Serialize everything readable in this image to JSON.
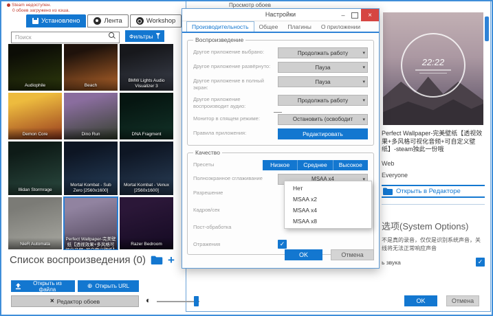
{
  "colors": {
    "accent": "#1377d0",
    "close_red": "#d64541",
    "status_red": "#c0392b"
  },
  "status": {
    "line1": "Steam недоступен.",
    "line2": "0 обоев загружено из кэша."
  },
  "browser": {
    "tabs": [
      {
        "label": "Установлено"
      },
      {
        "label": "Лента"
      },
      {
        "label": "Workshop"
      }
    ],
    "search_placeholder": "Поиск",
    "filters_label": "Фильтры",
    "tiles": [
      {
        "name": "Audiophile",
        "c1": "#0c0d06",
        "c2": "#2e3a0c"
      },
      {
        "name": "Beach",
        "c1": "#1f120b",
        "c2": "#b5652a"
      },
      {
        "name": "BMW Lights Audio Visualizer 3",
        "c1": "#17181c",
        "c2": "#3c414d"
      },
      {
        "name": "Demon Core",
        "c1": "#edbb3e",
        "c2": "#973a1e"
      },
      {
        "name": "Dino Run",
        "c1": "#8a6d9e",
        "c2": "#35402e"
      },
      {
        "name": "DNA Fragment",
        "c1": "#061611",
        "c2": "#123228"
      },
      {
        "name": "Illidan Stormrage",
        "c1": "#0e1b17",
        "c2": "#2b4a40"
      },
      {
        "name": "Mortal Kombat - Sub Zero [2560x1600]",
        "c1": "#0d1523",
        "c2": "#27405c"
      },
      {
        "name": "Mortal Kombat - Venux [2560x1600]",
        "c1": "#0e1624",
        "c2": "#2a3f58"
      },
      {
        "name": "NieR Automata",
        "c1": "#7b7b76",
        "c2": "#a8a8a1"
      },
      {
        "name": "Perfect Wallpaper-完美壁纸【透视效果+多风格可视化音频+可自定义壁纸】",
        "c1": "#9183a0",
        "c2": "#4e4458"
      },
      {
        "name": "Razer Bedroom",
        "c1": "#2b1738",
        "c2": "#140a22"
      }
    ],
    "playlist_heading": "Список воспроизведения (0)",
    "open_from_file_label": "Открыть из файла",
    "open_url_label": "Открыть URL",
    "editor_label": "Редактор обоев"
  },
  "preview_window": {
    "title": "Просмотр обоев",
    "clock_time": "22:22",
    "wallpaper_title": "Perfect Wallpaper-完美壁纸【透视效果+多风格可视化音频+可自定义壁纸】-steam独此一份哦",
    "type_value": "Web",
    "rating_value": "Everyone",
    "open_in_editor_label": "Открыть в Редакторе",
    "system_options_heading": "选项(System Options)",
    "system_options_text1": "不是真的录音，仅仅是识别系统声音，关",
    "system_options_text2": "线将无法正常响应声音",
    "audio_checkbox_label": "ь звука",
    "ok_label": "OK",
    "cancel_label": "Отмена"
  },
  "settings": {
    "title": "Настройки",
    "tabs": [
      {
        "label": "Производительность"
      },
      {
        "label": "Общее"
      },
      {
        "label": "Плагины"
      },
      {
        "label": "О приложении"
      }
    ],
    "playback": {
      "legend": "Воспроизведение",
      "rows": [
        {
          "label": "Другое приложение выбрано:",
          "value": "Продолжать работу"
        },
        {
          "label": "Другое приложение развёрнуто:",
          "value": "Пауза"
        },
        {
          "label": "Другое приложение в полный экран:",
          "value": "Пауза"
        },
        {
          "label": "Другое приложение воспроизводит аудио:",
          "value": "Продолжать работу"
        },
        {
          "label": "Монитор в спящем режиме:",
          "value": "Остановить (освободит"
        }
      ],
      "rules_label": "Правила приложения:",
      "rules_button_label": "Редактировать"
    },
    "quality": {
      "legend": "Качество",
      "presets_label": "Пресеты",
      "preset_low": "Низкое",
      "preset_med": "Среднее",
      "preset_high": "Высокое",
      "aa_label": "Полноэкранное сглаживание",
      "aa_value": "MSAA x4",
      "aa_options": [
        {
          "label": "Нет"
        },
        {
          "label": "MSAA x2"
        },
        {
          "label": "MSAA x4"
        },
        {
          "label": "MSAA x8"
        }
      ],
      "resolution_label": "Разрешение",
      "fps_label": "Кадров/сек",
      "post_label": "Пост-обработка",
      "reflections_label": "Отражения"
    },
    "ok_label": "OK",
    "cancel_label": "Отмена"
  }
}
